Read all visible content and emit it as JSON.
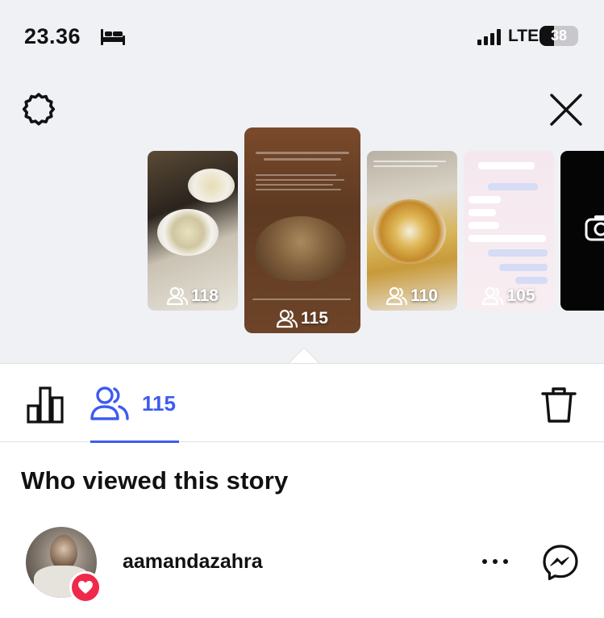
{
  "status_bar": {
    "time": "23.36",
    "network": "LTE",
    "battery": "38",
    "battery_level": 0.38,
    "icons": [
      "bed-icon",
      "signal-icon",
      "battery-icon"
    ]
  },
  "header": {
    "icons": [
      "gear-icon",
      "close-icon"
    ]
  },
  "stories": [
    {
      "viewers": "118",
      "selected": false,
      "icon": "viewers-icon"
    },
    {
      "viewers": "115",
      "selected": true,
      "icon": "viewers-icon"
    },
    {
      "viewers": "110",
      "selected": false,
      "icon": "viewers-icon"
    },
    {
      "viewers": "105",
      "selected": false,
      "icon": "viewers-icon"
    },
    {
      "viewers": "",
      "selected": false,
      "icon": "camera-icon"
    }
  ],
  "tabs": {
    "viewers_count": "115",
    "active_color": "#3d5bf0",
    "icons": [
      "insights-icon",
      "viewers-icon",
      "trash-icon"
    ]
  },
  "section": {
    "title": "Who viewed this story"
  },
  "viewers": [
    {
      "username": "aamandazahra",
      "reaction": "heart-icon",
      "reaction_color": "#f02849",
      "icons": [
        "more-icon",
        "messenger-icon"
      ]
    }
  ]
}
